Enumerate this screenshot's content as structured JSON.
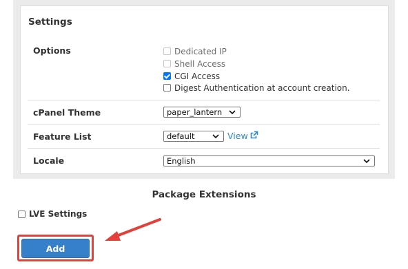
{
  "settings": {
    "title": "Settings",
    "options_label": "Options",
    "options": [
      {
        "label": "Dedicated IP",
        "checked": false,
        "disabled": true
      },
      {
        "label": "Shell Access",
        "checked": false,
        "disabled": true
      },
      {
        "label": "CGI Access",
        "checked": true,
        "disabled": false
      },
      {
        "label": "Digest Authentication at account creation.",
        "checked": false,
        "disabled": false
      }
    ],
    "cpanel_theme_label": "cPanel Theme",
    "cpanel_theme_value": "paper_lantern",
    "feature_list_label": "Feature List",
    "feature_list_value": "default",
    "view_link": "View",
    "locale_label": "Locale",
    "locale_value": "English"
  },
  "package_extensions": {
    "title": "Package Extensions",
    "lve_label": "LVE Settings",
    "lve_checked": false
  },
  "add_button": "Add",
  "colors": {
    "link": "#2d88c7",
    "button": "#3580c8",
    "highlight": "#e2403a",
    "checkbox_checked": "#0075ff"
  },
  "icons": [
    "chevron-down-icon",
    "external-link-icon",
    "check-icon",
    "annotation-arrow-icon"
  ]
}
